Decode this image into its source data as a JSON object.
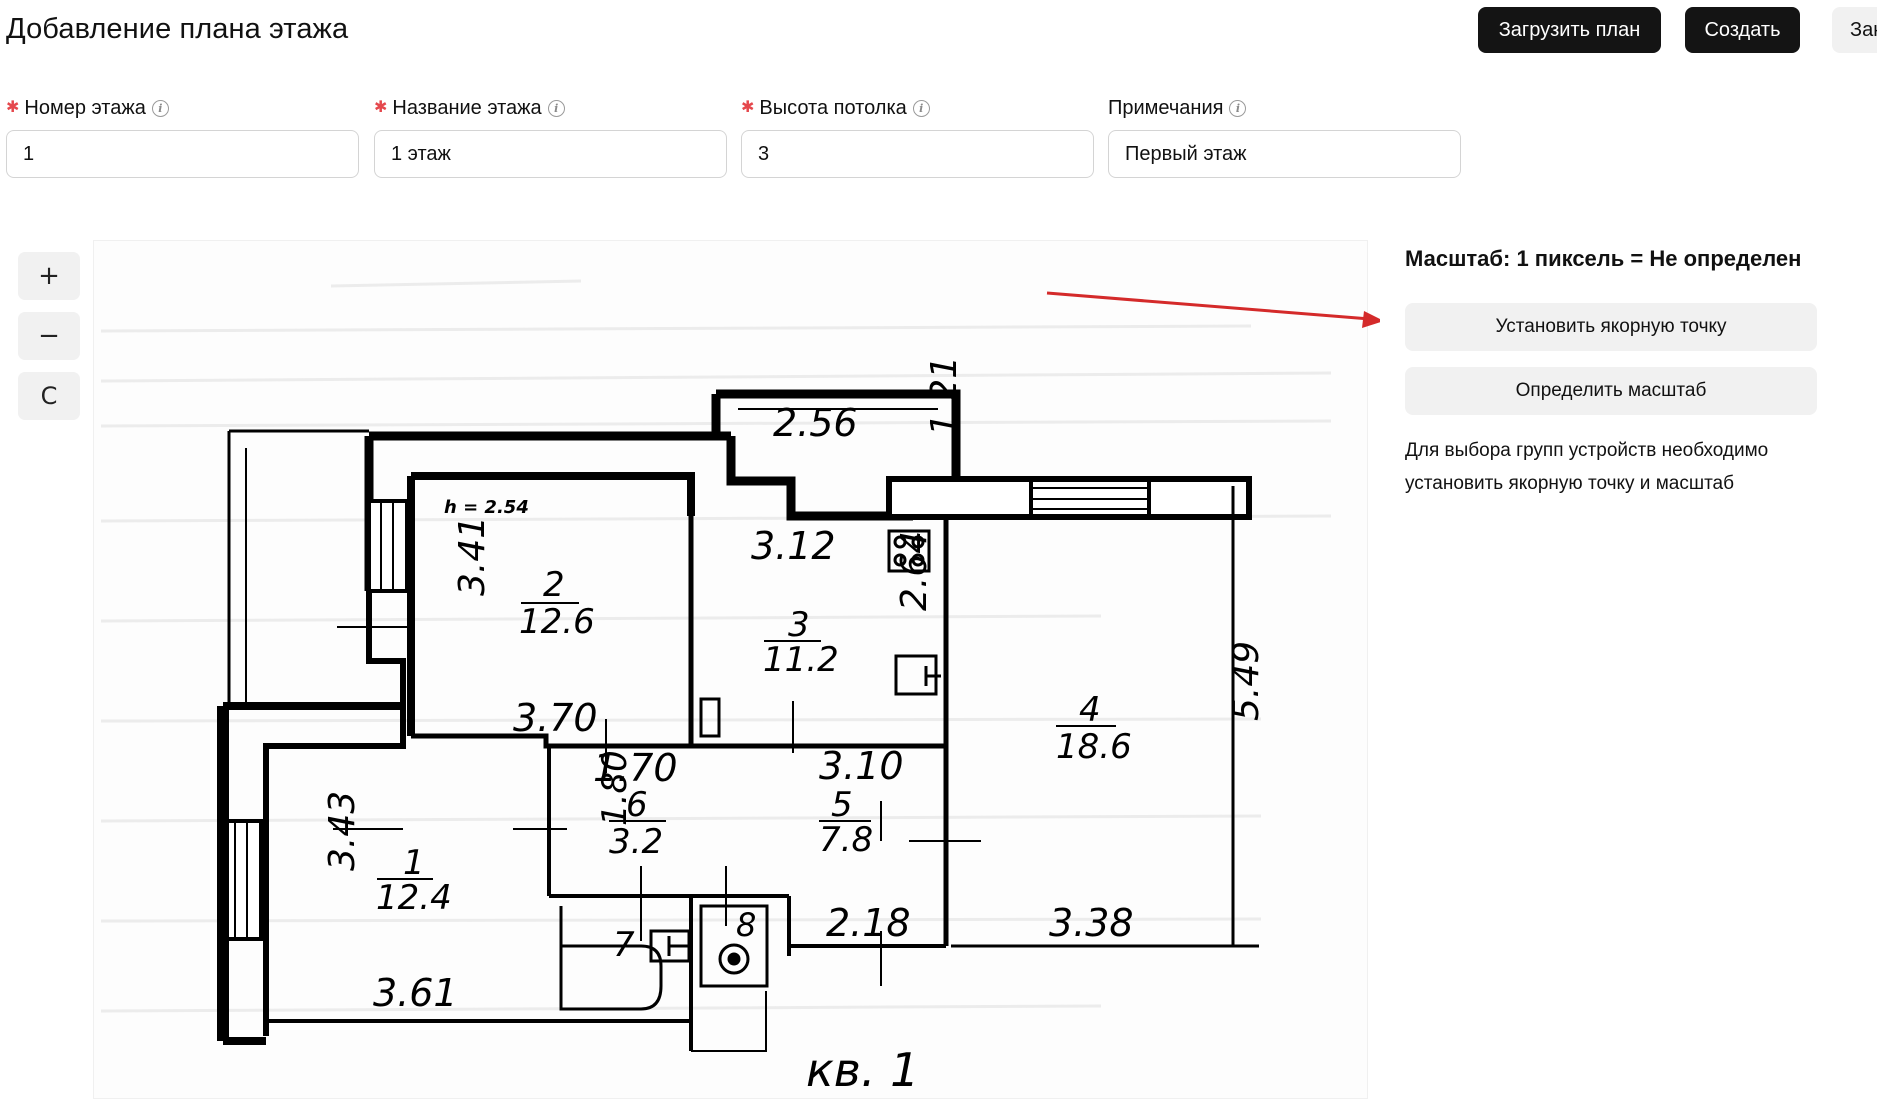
{
  "header": {
    "title": "Добавление плана этажа",
    "upload_button": "Загрузить план",
    "create_button": "Создать",
    "close_button": "Закрыть"
  },
  "form": {
    "floor_number": {
      "label": "Номер этажа",
      "required": true,
      "value": "1"
    },
    "floor_name": {
      "label": "Название этажа",
      "required": true,
      "value": "1 этаж"
    },
    "ceiling_height": {
      "label": "Высота потолка",
      "required": true,
      "value": "3"
    },
    "notes": {
      "label": "Примечания",
      "required": false,
      "value": "Первый этаж"
    }
  },
  "zoom": {
    "zoom_in": "+",
    "zoom_out": "−",
    "reset": "C"
  },
  "plan": {
    "caption": "кв. 1",
    "height_note": "h = 2.54",
    "dimensions": [
      "2.56",
      "1.21",
      "3.12",
      "2.64",
      "3.41",
      "3.70",
      "1.70",
      "3.10",
      "1.80",
      "5.49",
      "3.43",
      "2.18",
      "3.38",
      "3.61"
    ],
    "rooms": [
      {
        "number": "1",
        "area": "12.4"
      },
      {
        "number": "2",
        "area": "12.6"
      },
      {
        "number": "3",
        "area": "11.2"
      },
      {
        "number": "4",
        "area": "18.6"
      },
      {
        "number": "5",
        "area": "7.8"
      },
      {
        "number": "6",
        "area": "3.2"
      },
      {
        "number": "7",
        "area": ""
      },
      {
        "number": "8",
        "area": ""
      }
    ]
  },
  "sidebar": {
    "scale_text": "Масштаб: 1 пиксель = Не определен",
    "anchor_button": "Установить якорную точку",
    "scale_button": "Определить масштаб",
    "hint": "Для выбора групп устройств необходимо установить якорную точку и масштаб"
  },
  "colors": {
    "dark_button": "#141414",
    "light_button": "#f1f1f1",
    "required_star": "#e5484d",
    "annotation_arrow": "#d42a2a"
  },
  "icons": {
    "info": "info-circle-icon",
    "zoom_in": "plus-icon",
    "zoom_out": "minus-icon",
    "reset": "reset-icon"
  }
}
